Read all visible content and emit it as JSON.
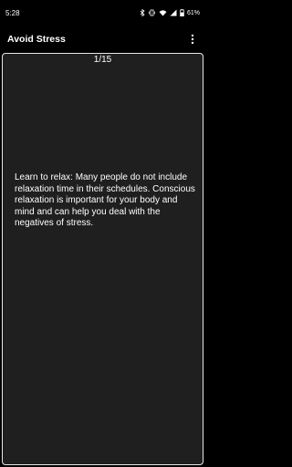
{
  "status_bar": {
    "time": "5:28",
    "battery": "61%",
    "icons": [
      "bluetooth-icon",
      "vibrate-icon",
      "wifi-icon",
      "signal-icon",
      "battery-icon"
    ]
  },
  "app_bar": {
    "title": "Avoid Stress",
    "menu_icon": "more-vert-icon"
  },
  "content": {
    "page_counter": "1/15",
    "tip": "Learn to relax: Many people do not include relaxation time in their schedules. Conscious relaxation is important for your body and mind and can help you deal with the negatives of stress."
  },
  "colors": {
    "background": "#000000",
    "card": "#1f1f1f",
    "card_border": "#e6e6e6",
    "text": "#ffffff"
  }
}
